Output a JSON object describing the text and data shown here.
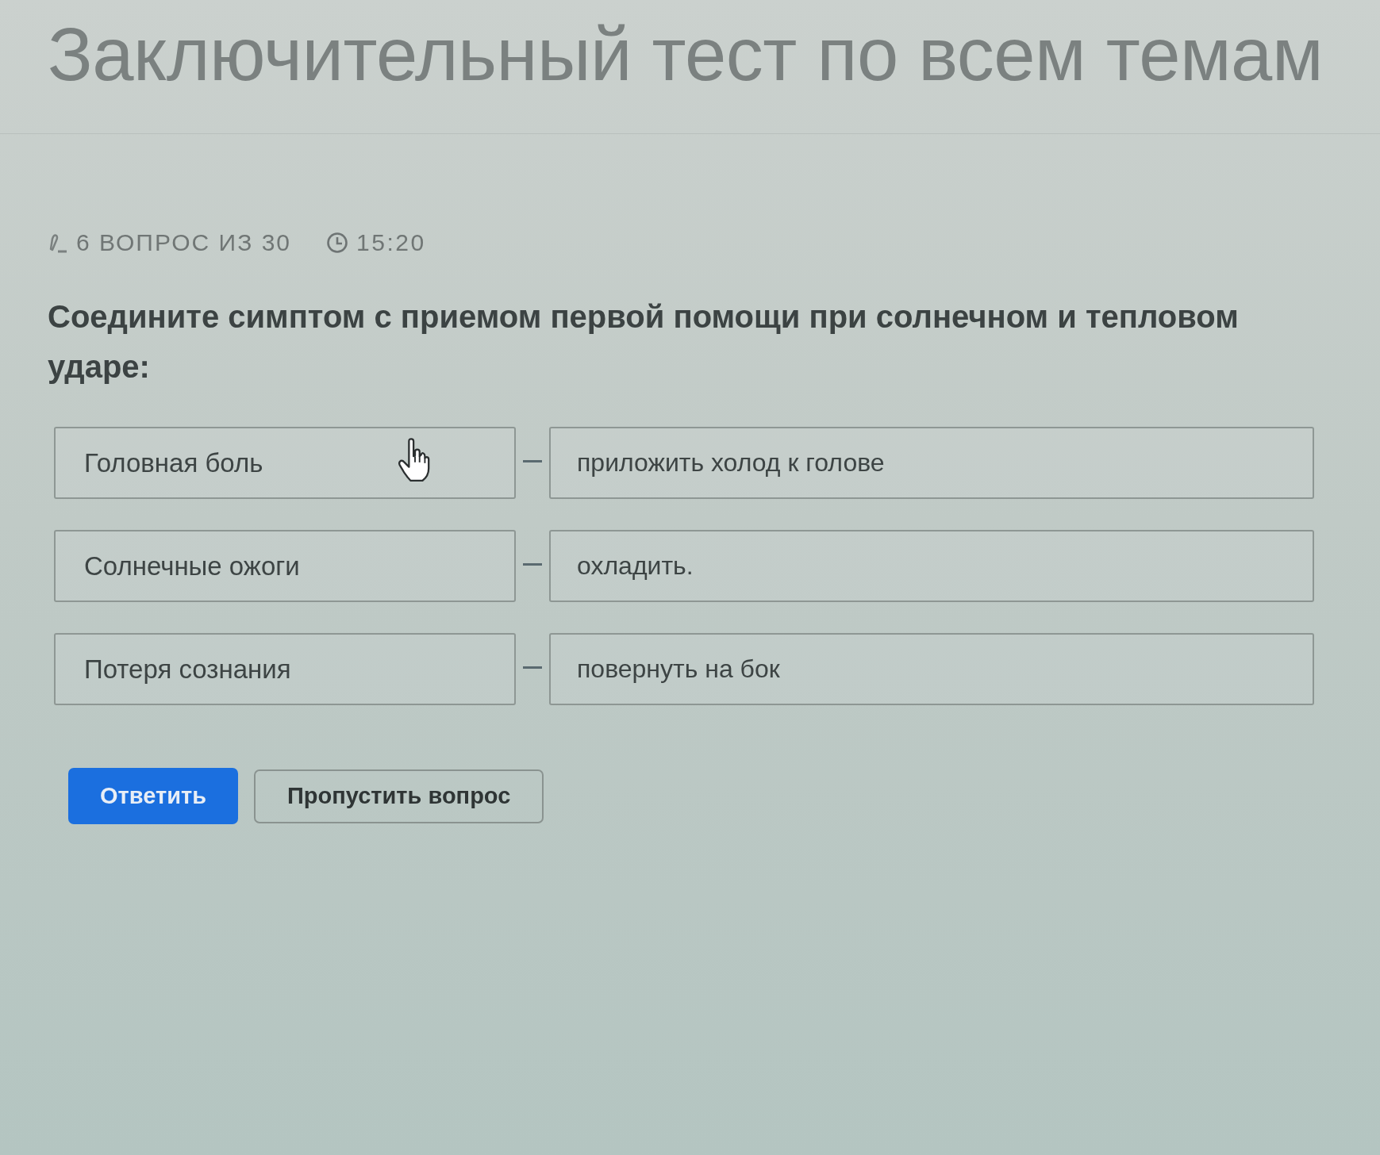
{
  "page": {
    "title": "Заключительный тест по всем темам"
  },
  "progress": {
    "counter": "6 ВОПРОС ИЗ 30",
    "timer": "15:20"
  },
  "question": {
    "text": "Соедините симптом с приемом первой помощи при солнечном и тепловом ударе:"
  },
  "pairs": [
    {
      "symptom": "Головная боль",
      "aid": "приложить холод к голове",
      "hovered": true
    },
    {
      "symptom": "Солнечные ожоги",
      "aid": "охладить.",
      "hovered": false
    },
    {
      "symptom": "Потеря сознания",
      "aid": "повернуть на бок",
      "hovered": false
    }
  ],
  "buttons": [
    {
      "label": "Ответить",
      "kind": "primary"
    },
    {
      "label": "Пропустить вопрос",
      "kind": "secondary"
    }
  ]
}
